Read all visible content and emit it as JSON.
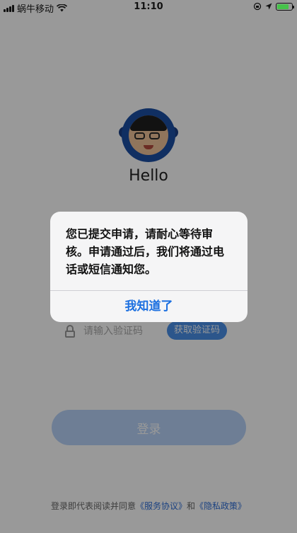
{
  "status_bar": {
    "carrier": "蜗牛移动",
    "time": "11:10",
    "icons": [
      "signal-icon",
      "wifi-icon",
      "orientation-lock-icon",
      "location-icon",
      "battery-icon"
    ],
    "battery_color": "#46c34a"
  },
  "login": {
    "greeting": "Hello",
    "code_placeholder": "请输入验证码",
    "get_code_label": "获取验证码",
    "login_label": "登录",
    "agreement_prefix": "登录即代表阅读并同意",
    "service_link": "《服务协议》",
    "agreement_and": "和",
    "privacy_link": "《隐私政策》"
  },
  "alert": {
    "message": "您已提交申请，请耐心等待审核。申请通过后，我们将通过电话或短信通知您。",
    "action_label": "我知道了"
  },
  "colors": {
    "accent": "#1b6fe0",
    "button_disabled": "#b7d3f8",
    "get_code_bg": "#4a8fe8",
    "avatar_bg": "#1c4fa3"
  }
}
